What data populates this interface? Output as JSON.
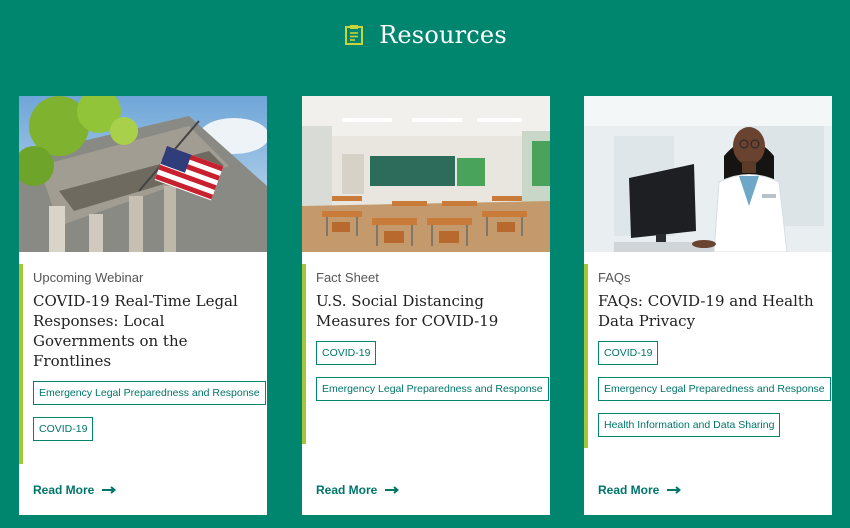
{
  "header": {
    "title": "Resources",
    "icon": "clipboard-icon",
    "icon_color": "#c8d43a"
  },
  "colors": {
    "background": "#00856f",
    "accent": "#a4c639",
    "link": "#00756a"
  },
  "cards": [
    {
      "type": "Upcoming Webinar",
      "title": "COVID-19 Real-Time Legal Responses: Local Governments on the Frontlines",
      "tags": [
        "Emergency Legal Preparedness and Response",
        "COVID-19"
      ],
      "read_more": "Read More",
      "image": "city-hall-flag"
    },
    {
      "type": "Fact Sheet",
      "title": "U.S. Social Distancing Measures for COVID-19",
      "tags": [
        "COVID-19",
        "Emergency Legal Preparedness and Response"
      ],
      "read_more": "Read More",
      "image": "empty-classroom"
    },
    {
      "type": "FAQs",
      "title": "FAQs: COVID-19 and Health Data Privacy",
      "tags": [
        "COVID-19",
        "Emergency Legal Preparedness and Response",
        "Health Information and Data Sharing"
      ],
      "read_more": "Read More",
      "image": "doctor-computer"
    }
  ]
}
